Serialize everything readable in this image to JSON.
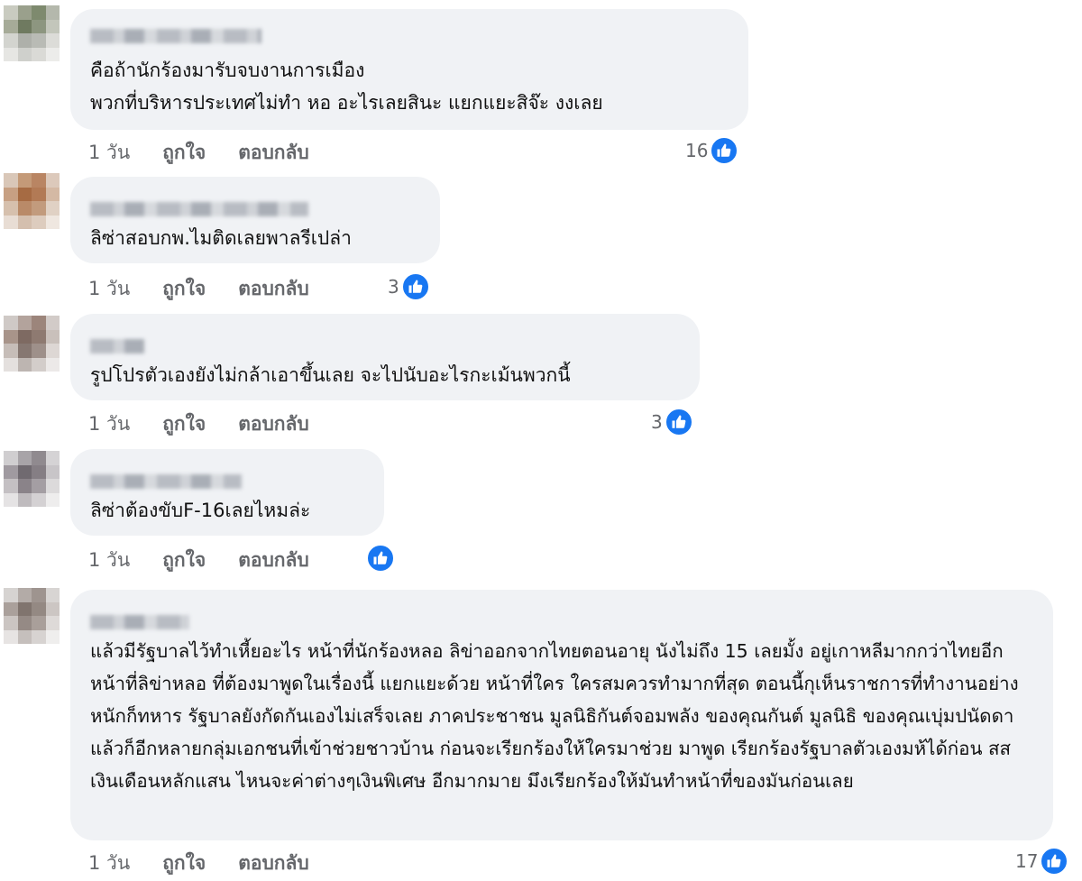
{
  "actions": {
    "time": "1 วัน",
    "like": "ถูกใจ",
    "reply": "ตอบกลับ"
  },
  "colors": {
    "bubble": "#f0f2f5",
    "like_blue": "#1877f2",
    "meta_gray": "#65676b"
  },
  "reaction_icon": "thumbs-up-icon",
  "comments": [
    {
      "text": "คือถ้านักร้องมารับจบงานการเมือง\nพวกที่บริหารประเทศไม่ทำ หอ อะไรเลยสินะ แยกแยะสิจ๊ะ งงเลย",
      "reactions": "16"
    },
    {
      "text": "ลิซ่าสอบกพ.ไมติดเลยพาลรีเปล่า",
      "reactions": "3"
    },
    {
      "text": "รูปโปรตัวเองยังไม่กล้าเอาขึ้นเลย จะไปนับอะไรกะเม้นพวกนี้",
      "reactions": "3"
    },
    {
      "text": "ลิซ่าต้องขับF-16เลยไหมล่ะ",
      "reactions": ""
    },
    {
      "text": "แล้วมีรัฐบาลไว้ทำเหี้ยอะไร หน้าที่นักร้องหลอ ลิข่าออกจากไทยตอนอายุ นังไม่ถึง 15 เลยมั้ง อยู่เกาหลีมากกว่าไทยอีก หน้าที่ลิข่าหลอ ที่ต้องมาพูดในเรื่องนี้ แยกแยะด้วย หน้าที่ใคร ใครสมควรทำมากที่สุด ตอนนี้กุเห็นราชการที่ทำงานอย่างหนักก็ทหาร รัฐบาลยังกัดกันเองไม่เสร็จเลย ภาคประชาชน มูลนิธิกันต์จอมพลัง ของคุณกันต์ มูลนิธิ ของคุณเบุ่มปนัดดา แล้วก็อีกหลายกลุ่มเอกชนที่เข้าช่วยชาวบ้าน ก่อนจะเรียกร้องให้ใครมาช่วย มาพูด เรียกร้องรัฐบาลตัวเองมห้ได้ก่อน สส เงินเดือนหลักแสน ไหนจะค่าต่างๆเงินพิเศษ อีกมากมาย มึงเรียกร้องให้มันทำหน้าที่ของมันก่อนเลย",
      "reactions": "17"
    }
  ]
}
